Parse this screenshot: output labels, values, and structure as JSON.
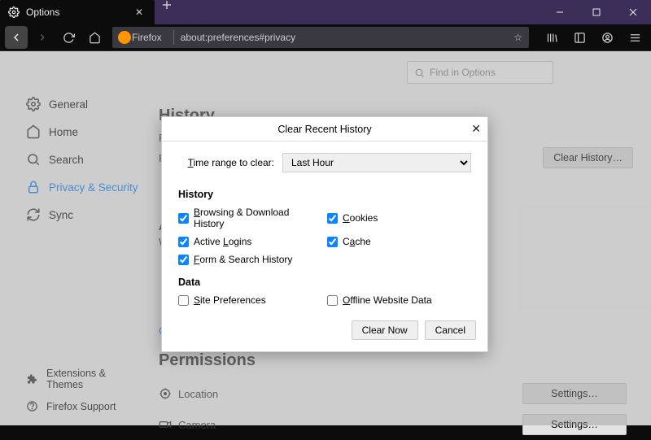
{
  "tab": {
    "title": "Options"
  },
  "urlbar": {
    "brand": "Firefox",
    "url": "about:preferences#privacy"
  },
  "search": {
    "placeholder": "Find in Options"
  },
  "sidebar": {
    "items": [
      {
        "label": "General"
      },
      {
        "label": "Home"
      },
      {
        "label": "Search"
      },
      {
        "label": "Privacy & Security"
      },
      {
        "label": "Sync"
      }
    ],
    "bottom": [
      {
        "label": "Extensions & Themes"
      },
      {
        "label": "Firefox Support"
      }
    ]
  },
  "main": {
    "history_heading": "History",
    "address_heading": "A",
    "w_line": "W",
    "c_line": "C",
    "clear_history_btn": "Clear History…",
    "permissions_heading": "Permissions",
    "perm": {
      "location": "Location",
      "camera": "Camera",
      "settings_btn": "Settings…"
    },
    "f_line1": "F",
    "f_line2": "F"
  },
  "dialog": {
    "title": "Clear Recent History",
    "range_label": "Time range to clear:",
    "range_value": "Last Hour",
    "sections": {
      "history": "History",
      "data": "Data"
    },
    "checks": {
      "browsing": "Browsing & Download History",
      "cookies": "Cookies",
      "logins": "Active Logins",
      "cache": "Cache",
      "form": "Form & Search History",
      "siteprefs": "Site Preferences",
      "offline": "Offline Website Data"
    },
    "buttons": {
      "clear": "Clear Now",
      "cancel": "Cancel"
    }
  }
}
